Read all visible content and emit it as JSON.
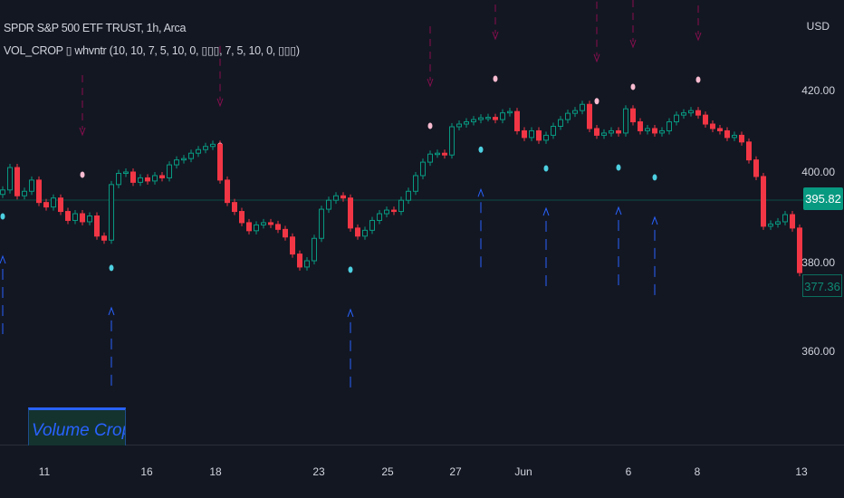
{
  "header": {
    "symbol_title": "SPDR S&P 500 ETF TRUST, 1h, Arca",
    "indicator_legend": "VOL_CROP ▯ whvntr (10, 10, 7, 5, 10, 0, ▯▯▯, 7, 5, 10, 0, ▯▯▯)"
  },
  "price_axis": {
    "currency": "USD",
    "ticks": [
      "420.00",
      "400.00",
      "380.00",
      "360.00"
    ],
    "last_price": "395.82",
    "close_label": "377.36"
  },
  "time_axis": {
    "ticks": [
      "11",
      "16",
      "18",
      "23",
      "25",
      "27",
      "Jun",
      "6",
      "8",
      "13"
    ]
  },
  "overlay": {
    "label": "Volume Crop"
  },
  "colors": {
    "background": "#131722",
    "up": "#089981",
    "down": "#f23645",
    "sell_dot": "#f8bbd0",
    "buy_dot": "#4dd0e1",
    "sell_arrow": "#880e4f",
    "buy_arrow": "#2962ff",
    "last_price": "#089981",
    "accent": "#2962ff"
  },
  "chart_data": {
    "type": "candlestick",
    "title": "",
    "xlabel": "",
    "ylabel": "USD",
    "ylim": [
      353,
      438
    ],
    "yticks": [
      360,
      380,
      400,
      420
    ],
    "grid": false,
    "last_price": 395.82,
    "closes": [
      395.8,
      400.8,
      394.5,
      395.5,
      398,
      393,
      392,
      394,
      391,
      389,
      390.5,
      388.7,
      390,
      385.5,
      384.6,
      397,
      399.5,
      399.8,
      397.5,
      398.5,
      397.8,
      399,
      398.5,
      401.4,
      402.5,
      402.8,
      404,
      404.8,
      405.5,
      406,
      398,
      393,
      391,
      388.5,
      386.7,
      388,
      388.5,
      388.1,
      387,
      385.3,
      381.5,
      378.6,
      380,
      385,
      391.5,
      393.5,
      394.5,
      394,
      387.3,
      385.5,
      386.8,
      389,
      390.5,
      391.3,
      391,
      393.5,
      395.5,
      399,
      402,
      403.8,
      404,
      403.6,
      409.9,
      410.5,
      411,
      411.5,
      411.9,
      412,
      411.5,
      413,
      413.3,
      409,
      407.5,
      409,
      406.9,
      408,
      410,
      411.5,
      412.9,
      413.5,
      414.9,
      409.5,
      408,
      408.5,
      409,
      408.5,
      413.9,
      411,
      409,
      409.5,
      408.5,
      409,
      411,
      412.5,
      413,
      413.5,
      412.5,
      410.5,
      409.5,
      409,
      407.5,
      408,
      406.5,
      402.5,
      398.8,
      387.7,
      388.2,
      388.7,
      390.3,
      387.3,
      377.36
    ],
    "sell_signals": [
      {
        "bar": 11,
        "price": 399.2
      },
      {
        "bar": 30,
        "price": 405.7
      },
      {
        "bar": 59,
        "price": 410.1
      },
      {
        "bar": 68,
        "price": 420.6
      },
      {
        "bar": 82,
        "price": 415.6
      },
      {
        "bar": 87,
        "price": 418.8
      },
      {
        "bar": 96,
        "price": 420.4
      }
    ],
    "buy_signals": [
      {
        "bar": 0,
        "price": 389.9
      },
      {
        "bar": 15,
        "price": 378.4
      },
      {
        "bar": 48,
        "price": 378.0
      },
      {
        "bar": 66,
        "price": 404.8
      },
      {
        "bar": 75,
        "price": 400.6
      },
      {
        "bar": 85,
        "price": 400.8
      },
      {
        "bar": 90,
        "price": 398.6
      }
    ]
  }
}
